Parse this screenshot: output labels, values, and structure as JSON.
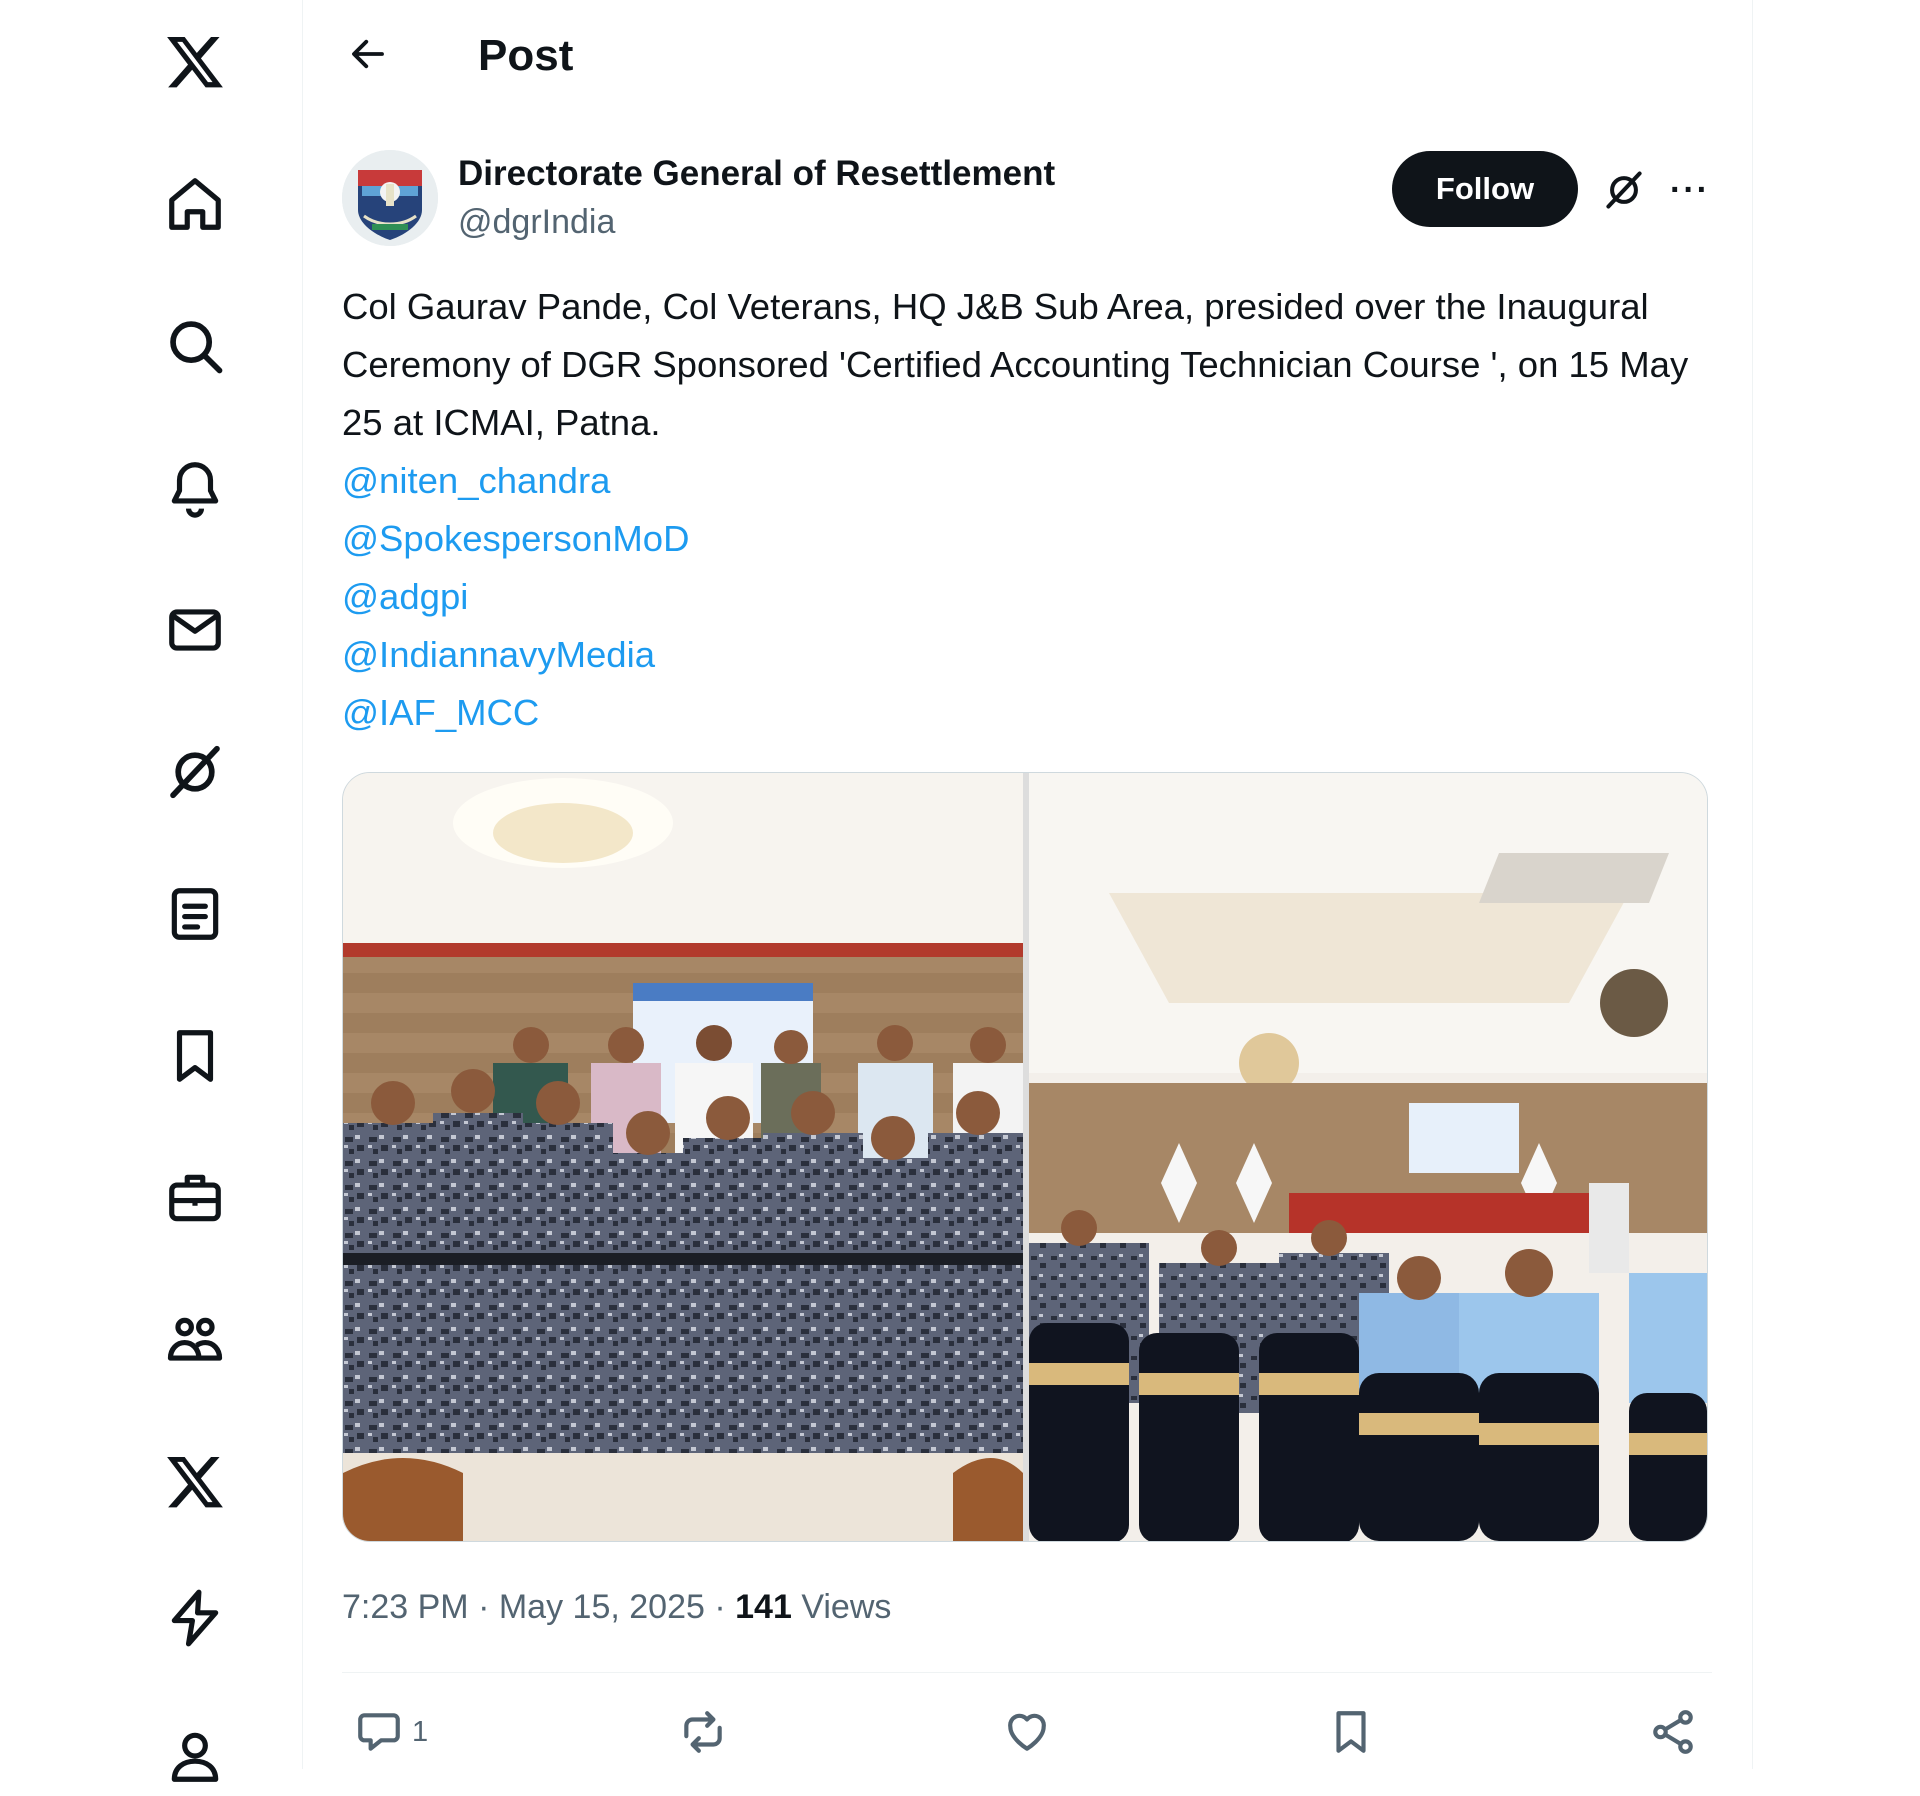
{
  "header": {
    "title": "Post"
  },
  "nav": {
    "items": [
      "x-logo-icon",
      "home-icon",
      "search-icon",
      "notifications-icon",
      "messages-icon",
      "grok-icon",
      "lists-icon",
      "bookmarks-icon",
      "jobs-icon",
      "communities-icon",
      "premium-icon",
      "verified-orgs-icon",
      "profile-icon"
    ]
  },
  "post": {
    "author_name": "Directorate General of Resettlement",
    "author_handle": "@dgrIndia",
    "follow_label": "Follow",
    "more_label": "···",
    "text": "Col Gaurav Pande, Col Veterans, HQ J&B Sub Area, presided over the Inaugural Ceremony of DGR Sponsored 'Certified Accounting Technician Course ', on 15 May 25 at ICMAI, Patna.",
    "mentions": [
      "@niten_chandra",
      "@SpokespersonMoD",
      "@adgpi",
      "@IndiannavyMedia",
      "@IAF_MCC"
    ],
    "time": "7:23 PM",
    "date": "May 15, 2025",
    "separator": "·",
    "views_count": "141",
    "views_label": "Views",
    "actions": {
      "reply_count": "1"
    }
  },
  "colors": {
    "accent": "#1d9bf0",
    "text": "#0f1419",
    "muted": "#536471",
    "follow_bg": "#0f1419"
  }
}
